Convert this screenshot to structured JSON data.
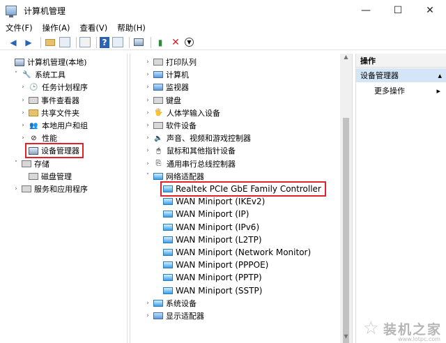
{
  "window": {
    "title": "计算机管理",
    "controls": {
      "minimize": "—",
      "maximize": "☐",
      "close": "✕"
    }
  },
  "menu": [
    "文件(F)",
    "操作(A)",
    "查看(V)",
    "帮助(H)"
  ],
  "left_tree": [
    {
      "label": "计算机管理(本地)",
      "icon": "computer-icon",
      "expand": "",
      "level": 0
    },
    {
      "label": "系统工具",
      "icon": "tools-icon",
      "expand": "˅",
      "level": 1
    },
    {
      "label": "任务计划程序",
      "icon": "clock-icon",
      "expand": "›",
      "level": 2
    },
    {
      "label": "事件查看器",
      "icon": "event-viewer-icon",
      "expand": "›",
      "level": 2
    },
    {
      "label": "共享文件夹",
      "icon": "shared-folder-icon",
      "expand": "›",
      "level": 2
    },
    {
      "label": "本地用户和组",
      "icon": "users-icon",
      "expand": "›",
      "level": 2
    },
    {
      "label": "性能",
      "icon": "performance-icon",
      "expand": "›",
      "level": 2
    },
    {
      "label": "设备管理器",
      "icon": "device-manager-icon",
      "expand": "",
      "level": 2,
      "highlighted": true
    },
    {
      "label": "存储",
      "icon": "storage-icon",
      "expand": "˅",
      "level": 1
    },
    {
      "label": "磁盘管理",
      "icon": "disk-icon",
      "expand": "",
      "level": 2
    },
    {
      "label": "服务和应用程序",
      "icon": "services-icon",
      "expand": "›",
      "level": 1
    }
  ],
  "device_tree": [
    {
      "label": "打印队列",
      "icon": "printer-icon",
      "expand": "›",
      "level": 0
    },
    {
      "label": "计算机",
      "icon": "monitor-icon",
      "expand": "›",
      "level": 0
    },
    {
      "label": "监视器",
      "icon": "monitor-icon",
      "expand": "›",
      "level": 0
    },
    {
      "label": "键盘",
      "icon": "keyboard-icon",
      "expand": "›",
      "level": 0
    },
    {
      "label": "人体学输入设备",
      "icon": "hid-icon",
      "expand": "›",
      "level": 0
    },
    {
      "label": "软件设备",
      "icon": "software-device-icon",
      "expand": "›",
      "level": 0
    },
    {
      "label": "声音、视频和游戏控制器",
      "icon": "speaker-icon",
      "expand": "›",
      "level": 0
    },
    {
      "label": "鼠标和其他指针设备",
      "icon": "mouse-icon",
      "expand": "›",
      "level": 0
    },
    {
      "label": "通用串行总线控制器",
      "icon": "usb-icon",
      "expand": "›",
      "level": 0
    },
    {
      "label": "网络适配器",
      "icon": "network-icon",
      "expand": "˅",
      "level": 0
    },
    {
      "label": "Realtek PCIe GbE Family Controller",
      "icon": "network-adapter-icon",
      "expand": "",
      "level": 1,
      "highlighted": true
    },
    {
      "label": "WAN Miniport (IKEv2)",
      "icon": "network-adapter-icon",
      "expand": "",
      "level": 1
    },
    {
      "label": "WAN Miniport (IP)",
      "icon": "network-adapter-icon",
      "expand": "",
      "level": 1
    },
    {
      "label": "WAN Miniport (IPv6)",
      "icon": "network-adapter-icon",
      "expand": "",
      "level": 1
    },
    {
      "label": "WAN Miniport (L2TP)",
      "icon": "network-adapter-icon",
      "expand": "",
      "level": 1
    },
    {
      "label": "WAN Miniport (Network Monitor)",
      "icon": "network-adapter-icon",
      "expand": "",
      "level": 1
    },
    {
      "label": "WAN Miniport (PPPOE)",
      "icon": "network-adapter-icon",
      "expand": "",
      "level": 1
    },
    {
      "label": "WAN Miniport (PPTP)",
      "icon": "network-adapter-icon",
      "expand": "",
      "level": 1
    },
    {
      "label": "WAN Miniport (SSTP)",
      "icon": "network-adapter-icon",
      "expand": "",
      "level": 1
    },
    {
      "label": "系统设备",
      "icon": "system-device-icon",
      "expand": "›",
      "level": 0
    },
    {
      "label": "显示适配器",
      "icon": "display-adapter-icon",
      "expand": "›",
      "level": 0
    }
  ],
  "actions": {
    "header": "操作",
    "selected": "设备管理器",
    "selected_arrow": "▴",
    "more": "更多操作",
    "more_arrow": "▸"
  },
  "watermark": {
    "text": "装机之家",
    "url": "www.lotpc.com"
  },
  "colors": {
    "highlight_box": "#e3212b",
    "selected_bg": "#d4e5f7"
  }
}
